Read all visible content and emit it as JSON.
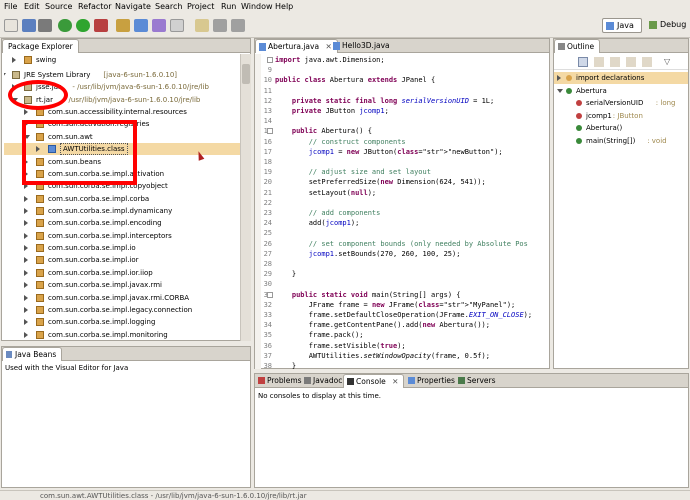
{
  "menu": [
    "File",
    "Edit",
    "Source",
    "Refactor",
    "Navigate",
    "Search",
    "Project",
    "Run",
    "Window",
    "Help"
  ],
  "perspectives": {
    "java": "Java",
    "debug": "Debug"
  },
  "package_explorer": {
    "tab": "Package Explorer",
    "rows": [
      {
        "label": "swing",
        "type": "pkg",
        "indent": 1,
        "exp": "r"
      },
      {
        "label": "JRE System Library",
        "suffix": " [java-6-sun-1.6.0.10]",
        "type": "jar",
        "indent": 0,
        "exp": "d"
      },
      {
        "label": "jsse.jar",
        "suffix": " - /usr/lib/jvm/java-6-sun-1.6.0.10/jre/lib",
        "type": "jar",
        "indent": 1,
        "exp": "r"
      },
      {
        "label": "rt.jar",
        "suffix": " - /usr/lib/jvm/java-6-sun-1.6.0.10/jre/lib",
        "type": "jar",
        "indent": 1,
        "exp": "d"
      },
      {
        "label": "com.sun.accessibility.internal.resources",
        "type": "pkg",
        "indent": 2,
        "exp": "r"
      },
      {
        "label": "com.sun.activation.registries",
        "type": "pkg",
        "indent": 2,
        "exp": "r"
      },
      {
        "label": "com.sun.awt",
        "type": "pkg",
        "indent": 2,
        "exp": "d"
      },
      {
        "label": "AWTUtilities.class",
        "type": "cls",
        "indent": 3,
        "exp": "r",
        "selected": true
      },
      {
        "label": "com.sun.beans",
        "type": "pkg",
        "indent": 2,
        "exp": "r"
      },
      {
        "label": "com.sun.corba.se.impl.activation",
        "type": "pkg",
        "indent": 2,
        "exp": "r"
      },
      {
        "label": "com.sun.corba.se.impl.copyobject",
        "type": "pkg",
        "indent": 2,
        "exp": "r"
      },
      {
        "label": "com.sun.corba.se.impl.corba",
        "type": "pkg",
        "indent": 2,
        "exp": "r"
      },
      {
        "label": "com.sun.corba.se.impl.dynamicany",
        "type": "pkg",
        "indent": 2,
        "exp": "r"
      },
      {
        "label": "com.sun.corba.se.impl.encoding",
        "type": "pkg",
        "indent": 2,
        "exp": "r"
      },
      {
        "label": "com.sun.corba.se.impl.interceptors",
        "type": "pkg",
        "indent": 2,
        "exp": "r"
      },
      {
        "label": "com.sun.corba.se.impl.io",
        "type": "pkg",
        "indent": 2,
        "exp": "r"
      },
      {
        "label": "com.sun.corba.se.impl.ior",
        "type": "pkg",
        "indent": 2,
        "exp": "r"
      },
      {
        "label": "com.sun.corba.se.impl.ior.iiop",
        "type": "pkg",
        "indent": 2,
        "exp": "r"
      },
      {
        "label": "com.sun.corba.se.impl.javax.rmi",
        "type": "pkg",
        "indent": 2,
        "exp": "r"
      },
      {
        "label": "com.sun.corba.se.impl.javax.rmi.CORBA",
        "type": "pkg",
        "indent": 2,
        "exp": "r"
      },
      {
        "label": "com.sun.corba.se.impl.legacy.connection",
        "type": "pkg",
        "indent": 2,
        "exp": "r"
      },
      {
        "label": "com.sun.corba.se.impl.logging",
        "type": "pkg",
        "indent": 2,
        "exp": "r"
      },
      {
        "label": "com.sun.corba.se.impl.monitoring",
        "type": "pkg",
        "indent": 2,
        "exp": "r"
      }
    ]
  },
  "java_beans": {
    "tab": "Java Beans",
    "text": "Used with the Visual Editor for Java"
  },
  "editor": {
    "tabs": [
      "Abertura.java",
      "Hello3D.java"
    ],
    "lines": [
      {
        "n": "1",
        "text": "import java.awt.Dimension;"
      },
      {
        "n": "9",
        "text": ""
      },
      {
        "n": "10",
        "text": "public class Abertura extends JPanel {"
      },
      {
        "n": "11",
        "text": ""
      },
      {
        "n": "12",
        "text": "    private static final long serialVersionUID = 1L;"
      },
      {
        "n": "13",
        "text": "    private JButton jcomp1;"
      },
      {
        "n": "14",
        "text": ""
      },
      {
        "n": "15",
        "text": "    public Abertura() {"
      },
      {
        "n": "16",
        "text": "        // construct components"
      },
      {
        "n": "17",
        "text": "        jcomp1 = new JButton(\"newButton\");"
      },
      {
        "n": "18",
        "text": ""
      },
      {
        "n": "19",
        "text": "        // adjust size and set layout"
      },
      {
        "n": "20",
        "text": "        setPreferredSize(new Dimension(624, 541));"
      },
      {
        "n": "21",
        "text": "        setLayout(null);"
      },
      {
        "n": "22",
        "text": ""
      },
      {
        "n": "23",
        "text": "        // add components"
      },
      {
        "n": "24",
        "text": "        add(jcomp1);"
      },
      {
        "n": "25",
        "text": ""
      },
      {
        "n": "26",
        "text": "        // set component bounds (only needed by Absolute Pos"
      },
      {
        "n": "27",
        "text": "        jcomp1.setBounds(270, 260, 100, 25);"
      },
      {
        "n": "28",
        "text": ""
      },
      {
        "n": "29",
        "text": "    }"
      },
      {
        "n": "30",
        "text": ""
      },
      {
        "n": "31",
        "text": "    public static void main(String[] args) {"
      },
      {
        "n": "32",
        "text": "        JFrame frame = new JFrame(\"MyPanel\");"
      },
      {
        "n": "33",
        "text": "        frame.setDefaultCloseOperation(JFrame.EXIT_ON_CLOSE);"
      },
      {
        "n": "34",
        "text": "        frame.getContentPane().add(new Abertura());"
      },
      {
        "n": "35",
        "text": "        frame.pack();"
      },
      {
        "n": "36",
        "text": "        frame.setVisible(true);"
      },
      {
        "n": "37",
        "text": "        AWTUtilities.setWindowOpacity(frame, 0.5f);"
      },
      {
        "n": "38",
        "text": "    }"
      },
      {
        "n": "39",
        "text": "}"
      }
    ]
  },
  "outline": {
    "tab": "Outline",
    "items": [
      {
        "label": "import declarations",
        "indent": 0,
        "selected": true
      },
      {
        "label": "Abertura",
        "indent": 0
      },
      {
        "label": "serialVersionUID",
        "suffix": " : long",
        "indent": 1
      },
      {
        "label": "jcomp1",
        "suffix": " : JButton",
        "indent": 1
      },
      {
        "label": "Abertura()",
        "indent": 1
      },
      {
        "label": "main(String[])",
        "suffix": " : void",
        "indent": 1
      }
    ]
  },
  "bottom_tabs": [
    "Problems",
    "Javadoc",
    "Console",
    "Properties",
    "Servers"
  ],
  "console_text": "No consoles to display at this time.",
  "status_text": "com.sun.awt.AWTUtilities.class - /usr/lib/jvm/java-6-sun-1.6.0.10/jre/lib/rt.jar",
  "colors": {
    "annotation": "#ff0000",
    "selection": "#f4d9a4"
  }
}
